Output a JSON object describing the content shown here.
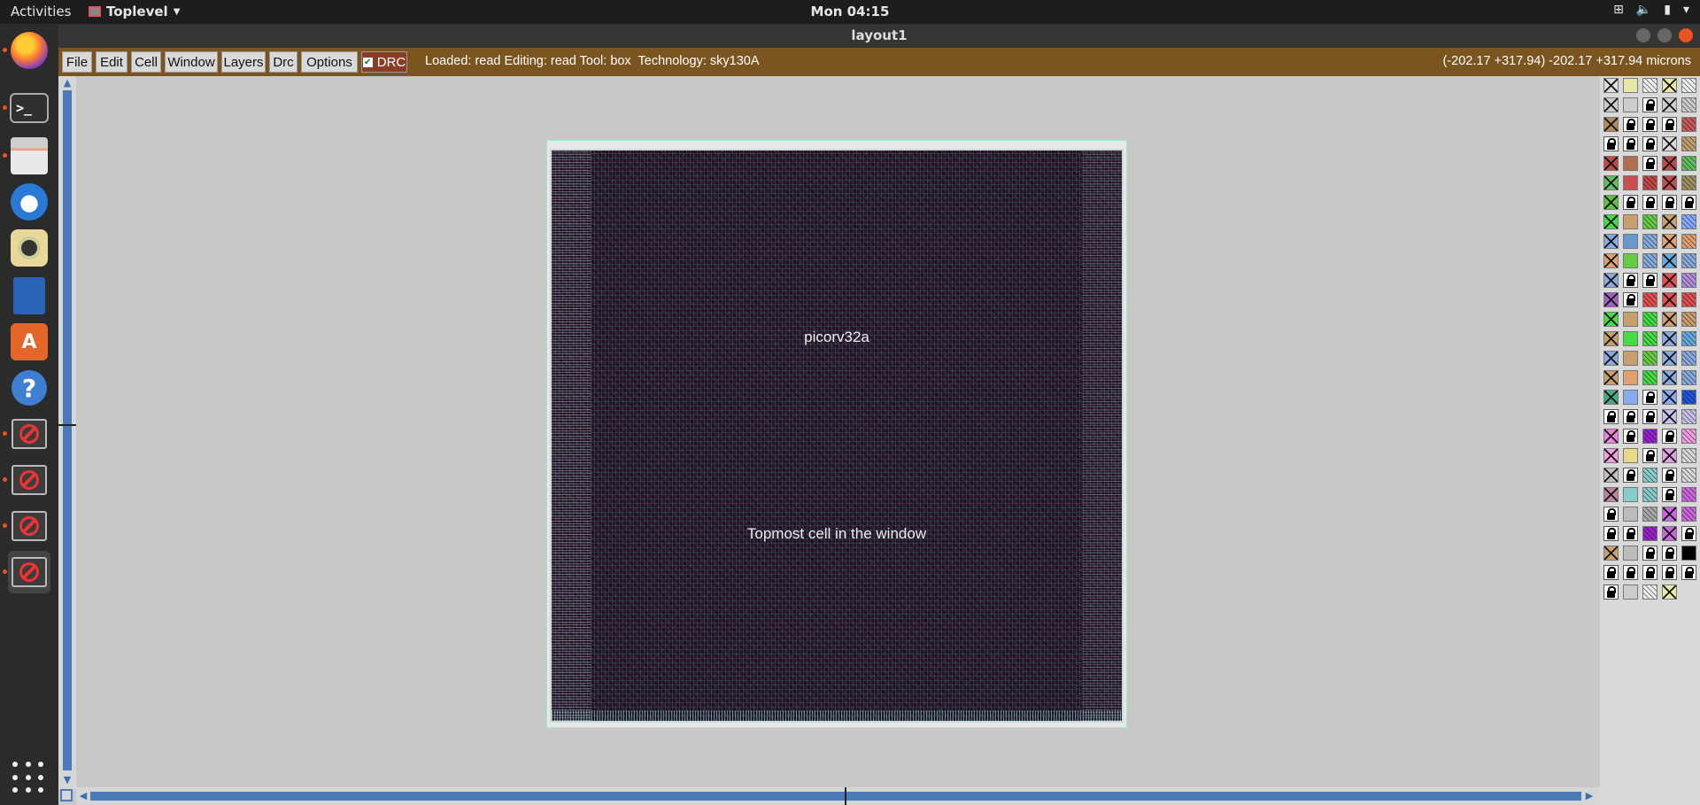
{
  "topbar": {
    "activities": "Activities",
    "app_menu": "Toplevel",
    "clock": "Mon 04:15"
  },
  "window": {
    "title": "layout1"
  },
  "menubar": {
    "file": "File",
    "edit": "Edit",
    "cell": "Cell",
    "window": "Window",
    "layers": "Layers",
    "drc": "Drc",
    "options": "Options",
    "drc_toggle": "DRC",
    "status": "Loaded: read Editing: read Tool: box  Technology: sky130A",
    "coords": "(-202.17 +317.94) -202.17 +317.94 microns"
  },
  "canvas": {
    "cell_name": "picorv32a",
    "cell_caption": "Topmost cell in the window"
  },
  "dock": {
    "items": [
      "firefox-icon",
      "terminal-icon",
      "files-icon",
      "thunderbird-icon",
      "rhythmbox-icon",
      "writer-icon",
      "software-icon",
      "help-icon",
      "no-entry-icon",
      "no-entry-icon",
      "no-entry-icon",
      "no-entry-icon"
    ]
  },
  "palette": {
    "colors": [
      "#dddddd",
      "#e7e7a8",
      "#eeeeee",
      "#e7e7a8",
      "#eeeeee",
      "#cccccc",
      "#cccccc",
      "LOCK",
      "#cccccc",
      "#cccccc",
      "#b08a5a",
      "LOCK",
      "LOCK",
      "LOCK",
      "#c85a5a",
      "LOCK",
      "LOCK",
      "LOCK",
      "#d8d8d8",
      "#c0a070",
      "#c04848",
      "#b07050",
      "LOCK",
      "#c04848",
      "#60c060",
      "#60c060",
      "#c85050",
      "#c04848",
      "#c05050",
      "#a09060",
      "#60c040",
      "LOCK",
      "LOCK",
      "LOCK",
      "LOCK",
      "#44dd44",
      "#c8a070",
      "#66cc44",
      "#c8a070",
      "#88aaff",
      "#88aadd",
      "#6699cc",
      "#88aadd",
      "#e0a070",
      "#e0a070",
      "#e0a070",
      "#66cc44",
      "#88aadd",
      "#66aadd",
      "#88aadd",
      "#88aadd",
      "LOCK",
      "LOCK",
      "#e05050",
      "#b090dd",
      "#a060c0",
      "LOCK",
      "#e05050",
      "#e05050",
      "#e05050",
      "#44dd44",
      "#c8a070",
      "#44dd44",
      "#c8a070",
      "#c8a070",
      "#c8a070",
      "#44dd44",
      "#44dd44",
      "#88aadd",
      "#66aadd",
      "#88aadd",
      "#c8a070",
      "#66cc44",
      "#88aadd",
      "#88aadd",
      "#c8a070",
      "#e0a070",
      "#44dd44",
      "#88aadd",
      "#88aadd",
      "#44aa88",
      "#88aaee",
      "LOCK",
      "#88aaee",
      "#2255dd",
      "LOCK",
      "LOCK",
      "LOCK",
      "#c8c0e8",
      "#c8c0e8",
      "#f080e0",
      "LOCK",
      "#9922cc",
      "LOCK",
      "#f0a0e0",
      "#f0a0e0",
      "#e8d888",
      "LOCK",
      "#e0a0e0",
      "#d8d8d8",
      "#c0c0c0",
      "LOCK",
      "#88cccc",
      "LOCK",
      "#d8d8d8",
      "#c080a0",
      "#88cccc",
      "#88cccc",
      "LOCK",
      "#cc66dd",
      "LOCK",
      "#bbbbbb",
      "#aaaaaa",
      "#cc66dd",
      "#cc66dd",
      "LOCK",
      "LOCK",
      "#9922cc",
      "#cc66dd",
      "LOCK",
      "#c8a070",
      "#bbbbbb",
      "LOCK",
      "LOCK",
      "#000000",
      "LOCK",
      "LOCK",
      "LOCK",
      "LOCK",
      "LOCK",
      "LOCK",
      "#cccccc",
      "#eeeeee",
      "#e7e7a8"
    ]
  }
}
